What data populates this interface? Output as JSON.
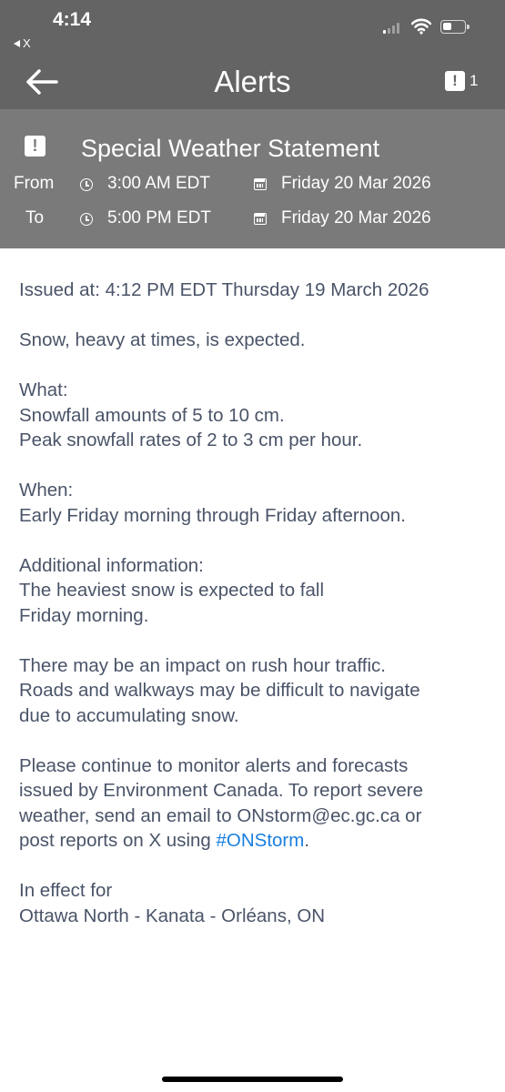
{
  "status_bar": {
    "time": "4:14",
    "back_app_label": "X"
  },
  "nav": {
    "title": "Alerts",
    "alert_count": "1"
  },
  "alert": {
    "title": "Special Weather Statement",
    "from_label": "From",
    "from_time": "3:00 AM EDT",
    "from_date": "Friday 20 Mar 2026",
    "to_label": "To",
    "to_time": "5:00 PM EDT",
    "to_date": "Friday 20 Mar 2026"
  },
  "body": {
    "issued": "Issued at: 4:12 PM EDT Thursday 19 March 2026",
    "summary": "Snow, heavy at times, is expected.",
    "what_heading": "What:",
    "what_line1": "Snowfall amounts of 5 to 10 cm.",
    "what_line2": "Peak snowfall rates of 2 to 3 cm per hour.",
    "when_heading": "When:",
    "when_line1": "Early Friday morning through Friday afternoon.",
    "addl_heading": "Additional information:",
    "addl_line1": "The heaviest snow is expected to fall",
    "addl_line2": "Friday morning.",
    "impact_line1": "There may be an impact on rush hour traffic.",
    "impact_line2": "Roads and walkways may be difficult to navigate",
    "impact_line3": "due to accumulating snow.",
    "monitor_line1": "Please continue to monitor alerts and forecasts",
    "monitor_line2": "issued by Environment Canada. To report severe",
    "monitor_line3": "weather, send an email to ONstorm@ec.gc.ca or",
    "monitor_line4_prefix": "post reports on X using ",
    "monitor_hashtag": "#ONStorm",
    "monitor_line4_suffix": ".",
    "effect_heading": "In effect for",
    "effect_location": "Ottawa North - Kanata - Orléans, ON"
  },
  "colors": {
    "nav_bg": "#646464",
    "header_bg": "#7a7a7a",
    "body_text": "#4a5468",
    "link": "#1a7fe0"
  },
  "icons": {
    "back": "arrow-left-icon",
    "alert": "exclamation-box-icon",
    "time": "clock-icon",
    "date": "calendar-icon"
  }
}
